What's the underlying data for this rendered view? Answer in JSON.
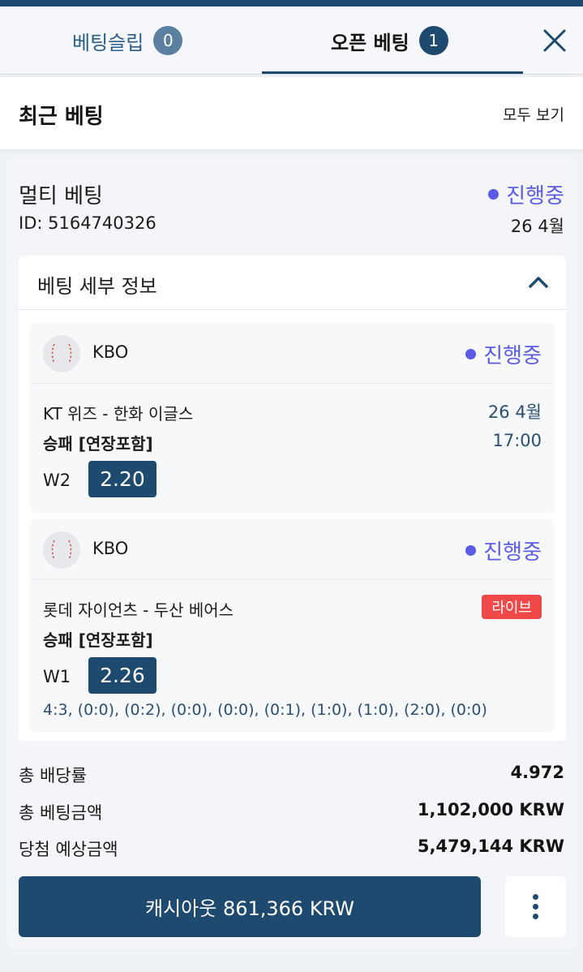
{
  "tabs": {
    "betslip": {
      "label": "베팅슬립",
      "count": "0"
    },
    "open": {
      "label": "오픈 베팅",
      "count": "1"
    }
  },
  "recent": {
    "title": "최근 베팅",
    "view_all": "모두 보기"
  },
  "bet": {
    "type": "멀티 베팅",
    "status": "진행중",
    "id": "ID: 5164740326",
    "date": "26 4월",
    "details_title": "베팅 세부 정보",
    "events": [
      {
        "league": "KBO",
        "status": "진행중",
        "match": "KT 위즈 - 한화 이글스",
        "date": "26 4월",
        "time": "17:00",
        "market": "승패 [연장포함]",
        "pick": "W2",
        "odds": "2.20"
      },
      {
        "league": "KBO",
        "status": "진행중",
        "match": "롯데 자이언츠 - 두산 베어스",
        "live": "라이브",
        "market": "승패 [연장포함]",
        "pick": "W1",
        "odds": "2.26",
        "score": "4:3, (0:0), (0:2), (0:0), (0:0), (0:1), (1:0), (1:0), (2:0), (0:0)"
      }
    ]
  },
  "summary": {
    "total_odds_label": "총 배당률",
    "total_odds": "4.972",
    "stake_label": "총 베팅금액",
    "stake": "1,102,000 KRW",
    "potential_label": "당첨 예상금액",
    "potential": "5,479,144 KRW"
  },
  "cashout": {
    "label": "캐시아웃 861,366 KRW"
  },
  "colors": {
    "primary": "#1f4a6f",
    "status": "#5a5ce6",
    "live": "#f04848",
    "secondary_text": "#2a4f72"
  },
  "icons": [
    "close-icon",
    "chevron-up-icon",
    "baseball-icon",
    "more-vertical-icon"
  ]
}
